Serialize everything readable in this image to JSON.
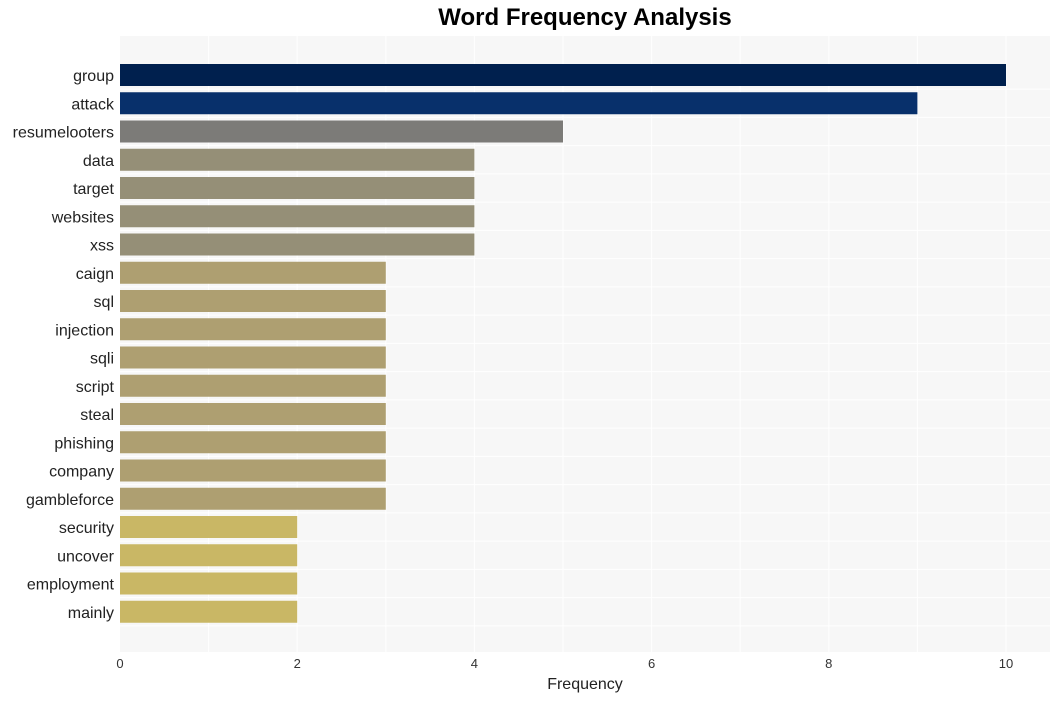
{
  "chart_data": {
    "type": "bar",
    "orientation": "horizontal",
    "title": "Word Frequency Analysis",
    "xlabel": "Frequency",
    "ylabel": "",
    "xlim": [
      0,
      10.5
    ],
    "xticks": [
      0,
      2,
      4,
      6,
      8,
      10
    ],
    "grid": true,
    "categories": [
      "group",
      "attack",
      "resumelooters",
      "data",
      "target",
      "websites",
      "xss",
      "caign",
      "sql",
      "injection",
      "sqli",
      "script",
      "steal",
      "phishing",
      "company",
      "gambleforce",
      "security",
      "uncover",
      "employment",
      "mainly"
    ],
    "values": [
      10,
      9,
      5,
      4,
      4,
      4,
      4,
      3,
      3,
      3,
      3,
      3,
      3,
      3,
      3,
      3,
      2,
      2,
      2,
      2
    ],
    "colors": [
      "#00204e",
      "#08306b",
      "#7c7b78",
      "#958f77",
      "#958f77",
      "#958f77",
      "#958f77",
      "#ae9f71",
      "#ae9f71",
      "#ae9f71",
      "#ae9f71",
      "#ae9f71",
      "#ae9f71",
      "#ae9f71",
      "#ae9f71",
      "#ae9f71",
      "#c9b765",
      "#c9b765",
      "#c9b765",
      "#c9b765"
    ]
  }
}
